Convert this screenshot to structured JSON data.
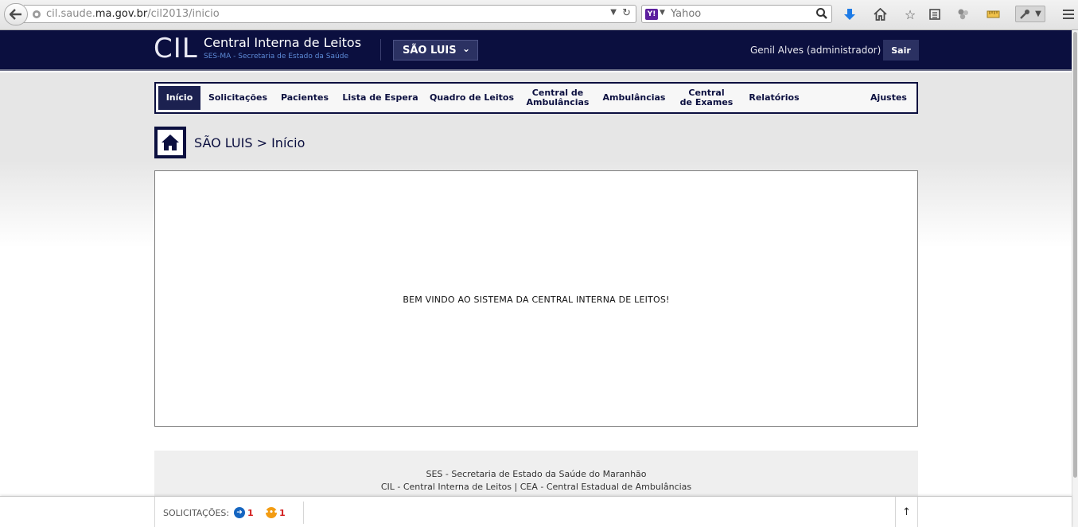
{
  "browser": {
    "url_prefix": "cil.saude.",
    "url_domain": "ma.gov.br",
    "url_path": "/cil2013/inicio",
    "search_placeholder": "Yahoo",
    "search_engine_logo": "Y!"
  },
  "header": {
    "logo": "CIL",
    "title": "Central Interna de Leitos",
    "subtitle": "SES-MA - Secretaria de Estado da Saúde",
    "city": "SÃO LUIS",
    "user": "Genil Alves (administrador)",
    "logout_label": "Sair"
  },
  "nav": {
    "items": [
      {
        "label": "Início",
        "active": true
      },
      {
        "label": "Solicitações"
      },
      {
        "label": "Pacientes"
      },
      {
        "label": "Lista de Espera"
      },
      {
        "label": "Quadro de Leitos"
      },
      {
        "label": "Central de Ambulâncias",
        "line1": "Central de",
        "line2": "Ambulâncias"
      },
      {
        "label": "Ambulâncias"
      },
      {
        "label": "Central de Exames",
        "line1": "Central",
        "line2": "de Exames"
      },
      {
        "label": "Relatórios"
      },
      {
        "label": "Ajustes"
      }
    ]
  },
  "breadcrumb": "SÃO LUIS > Início",
  "main": {
    "welcome": "BEM VINDO AO SISTEMA DA CENTRAL INTERNA DE LEITOS!"
  },
  "footer": {
    "line1": "SES - Secretaria de Estado da Saúde do Maranhão",
    "line2": "CIL - Central Interna de Leitos | CEA - Central Estadual de Ambulâncias"
  },
  "bottom_bar": {
    "label": "SOLICITAÇÕES:",
    "incoming_count": "1",
    "pending_count": "1",
    "incoming_color": "#1565c0",
    "pending_color": "#f39c12",
    "up_icon": "↑"
  },
  "colors": {
    "brand_navy": "#0b0f3f",
    "active_nav": "#1c2150",
    "subtitle_blue": "#5d8ad6"
  }
}
